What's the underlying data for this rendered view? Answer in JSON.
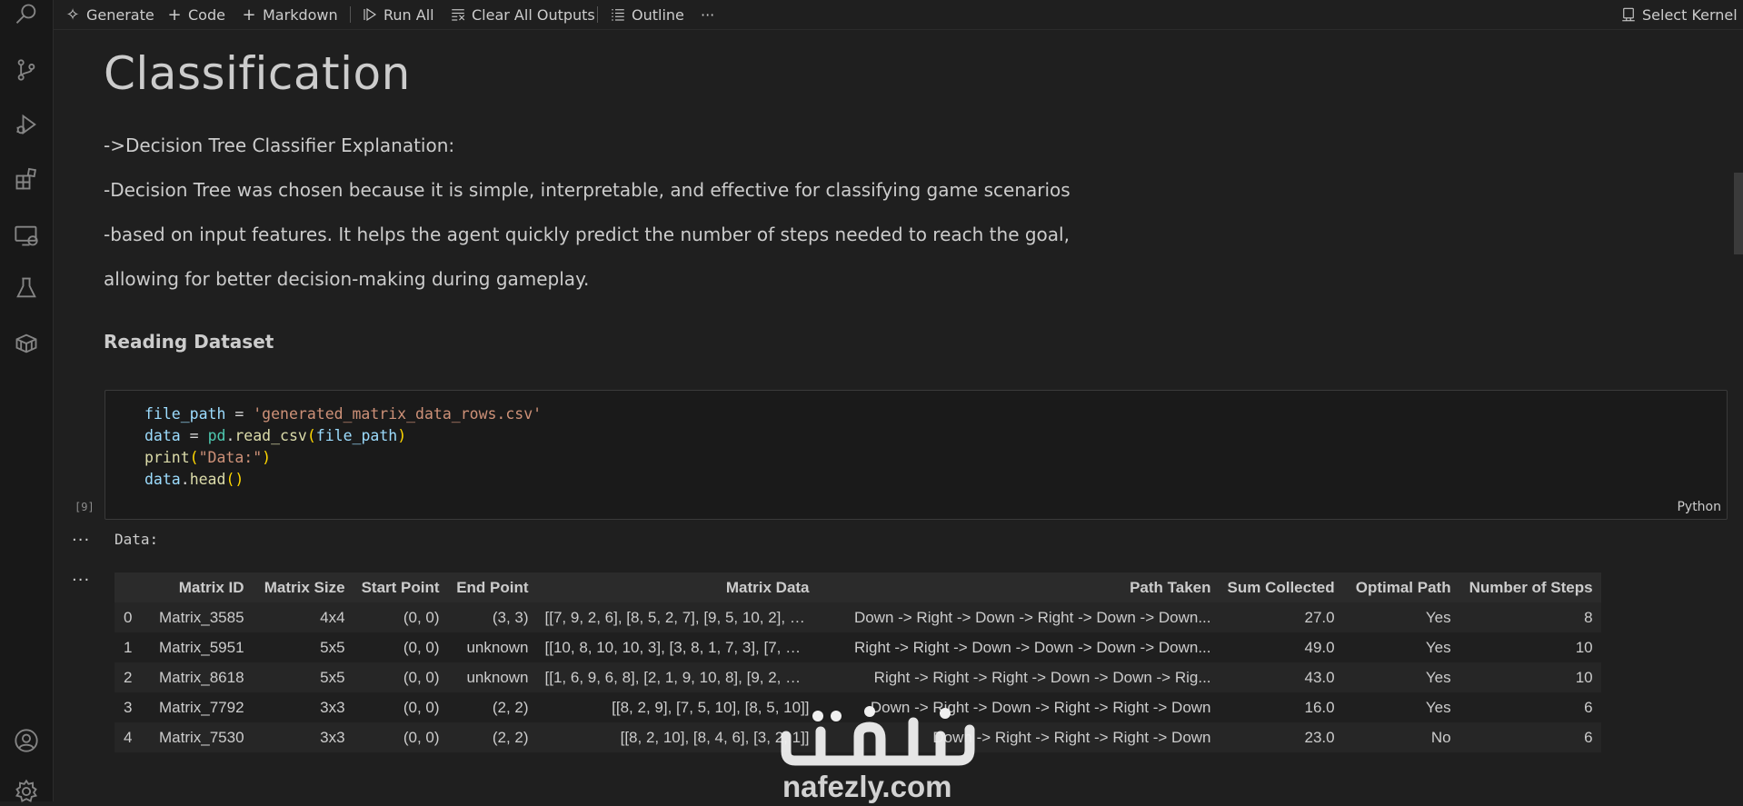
{
  "toolbar": {
    "generate": "Generate",
    "code": "Code",
    "markdown": "Markdown",
    "run_all": "Run All",
    "clear_all_outputs": "Clear All Outputs",
    "outline": "Outline",
    "more": "···",
    "select_kernel": "Select Kernel"
  },
  "markdown": {
    "title": "Classification",
    "lines": [
      "->Decision Tree Classifier Explanation:",
      "-Decision Tree was chosen because it is simple, interpretable, and effective for classifying game scenarios",
      "-based on input features. It helps the agent quickly predict the number of steps needed to reach the goal,",
      "allowing for better decision-making during gameplay."
    ],
    "heading": "Reading Dataset"
  },
  "code_cell": {
    "execution_count": "[9]",
    "language": "Python",
    "lines": [
      "file_path = 'generated_matrix_data_rows.csv'",
      "data = pd.read_csv(file_path)",
      "print(\"Data:\")",
      "data.head()"
    ]
  },
  "output": {
    "dots": "···",
    "stdout": "Data:",
    "table": {
      "columns": [
        "",
        "Matrix ID",
        "Matrix Size",
        "Start Point",
        "End Point",
        "Matrix Data",
        "Path Taken",
        "Sum Collected",
        "Optimal Path",
        "Number of Steps"
      ],
      "rows": [
        [
          "0",
          "Matrix_3585",
          "4x4",
          "(0, 0)",
          "(3, 3)",
          "[[7, 9, 2, 6], [8, 5, 2, 7], [9, 5, 10, 2], [2...",
          "Down -> Right -> Down -> Right -> Down -> Down...",
          "27.0",
          "Yes",
          "8"
        ],
        [
          "1",
          "Matrix_5951",
          "5x5",
          "(0, 0)",
          "unknown",
          "[[10, 8, 10, 10, 3], [3, 8, 1, 7, 3], [7, 5, 2...",
          "Right -> Right -> Down -> Down -> Down -> Down...",
          "49.0",
          "Yes",
          "10"
        ],
        [
          "2",
          "Matrix_8618",
          "5x5",
          "(0, 0)",
          "unknown",
          "[[1, 6, 9, 6, 8], [2, 1, 9, 10, 8], [9, 2, 3, ...",
          "Right -> Right -> Right -> Down -> Down -> Rig...",
          "43.0",
          "Yes",
          "10"
        ],
        [
          "3",
          "Matrix_7792",
          "3x3",
          "(0, 0)",
          "(2, 2)",
          "[[8, 2, 9], [7, 5, 10], [8, 5, 10]]",
          "Down -> Right -> Down -> Right -> Right -> Down",
          "16.0",
          "Yes",
          "6"
        ],
        [
          "4",
          "Matrix_7530",
          "3x3",
          "(0, 0)",
          "(2, 2)",
          "[[8, 2, 10], [8, 4, 6], [3, 2, 1]]",
          "Down -> Right -> Right -> Right -> Down",
          "23.0",
          "No",
          "6"
        ]
      ]
    }
  },
  "watermark": {
    "arabic": "نفذلي",
    "latin": "nafezly.com"
  },
  "icons": {
    "activity_bar": [
      "search-icon",
      "source-control-icon",
      "run-debug-icon",
      "extensions-icon",
      "remote-explorer-icon",
      "testing-icon",
      "containers-icon",
      "account-icon",
      "settings-gear-icon"
    ]
  }
}
